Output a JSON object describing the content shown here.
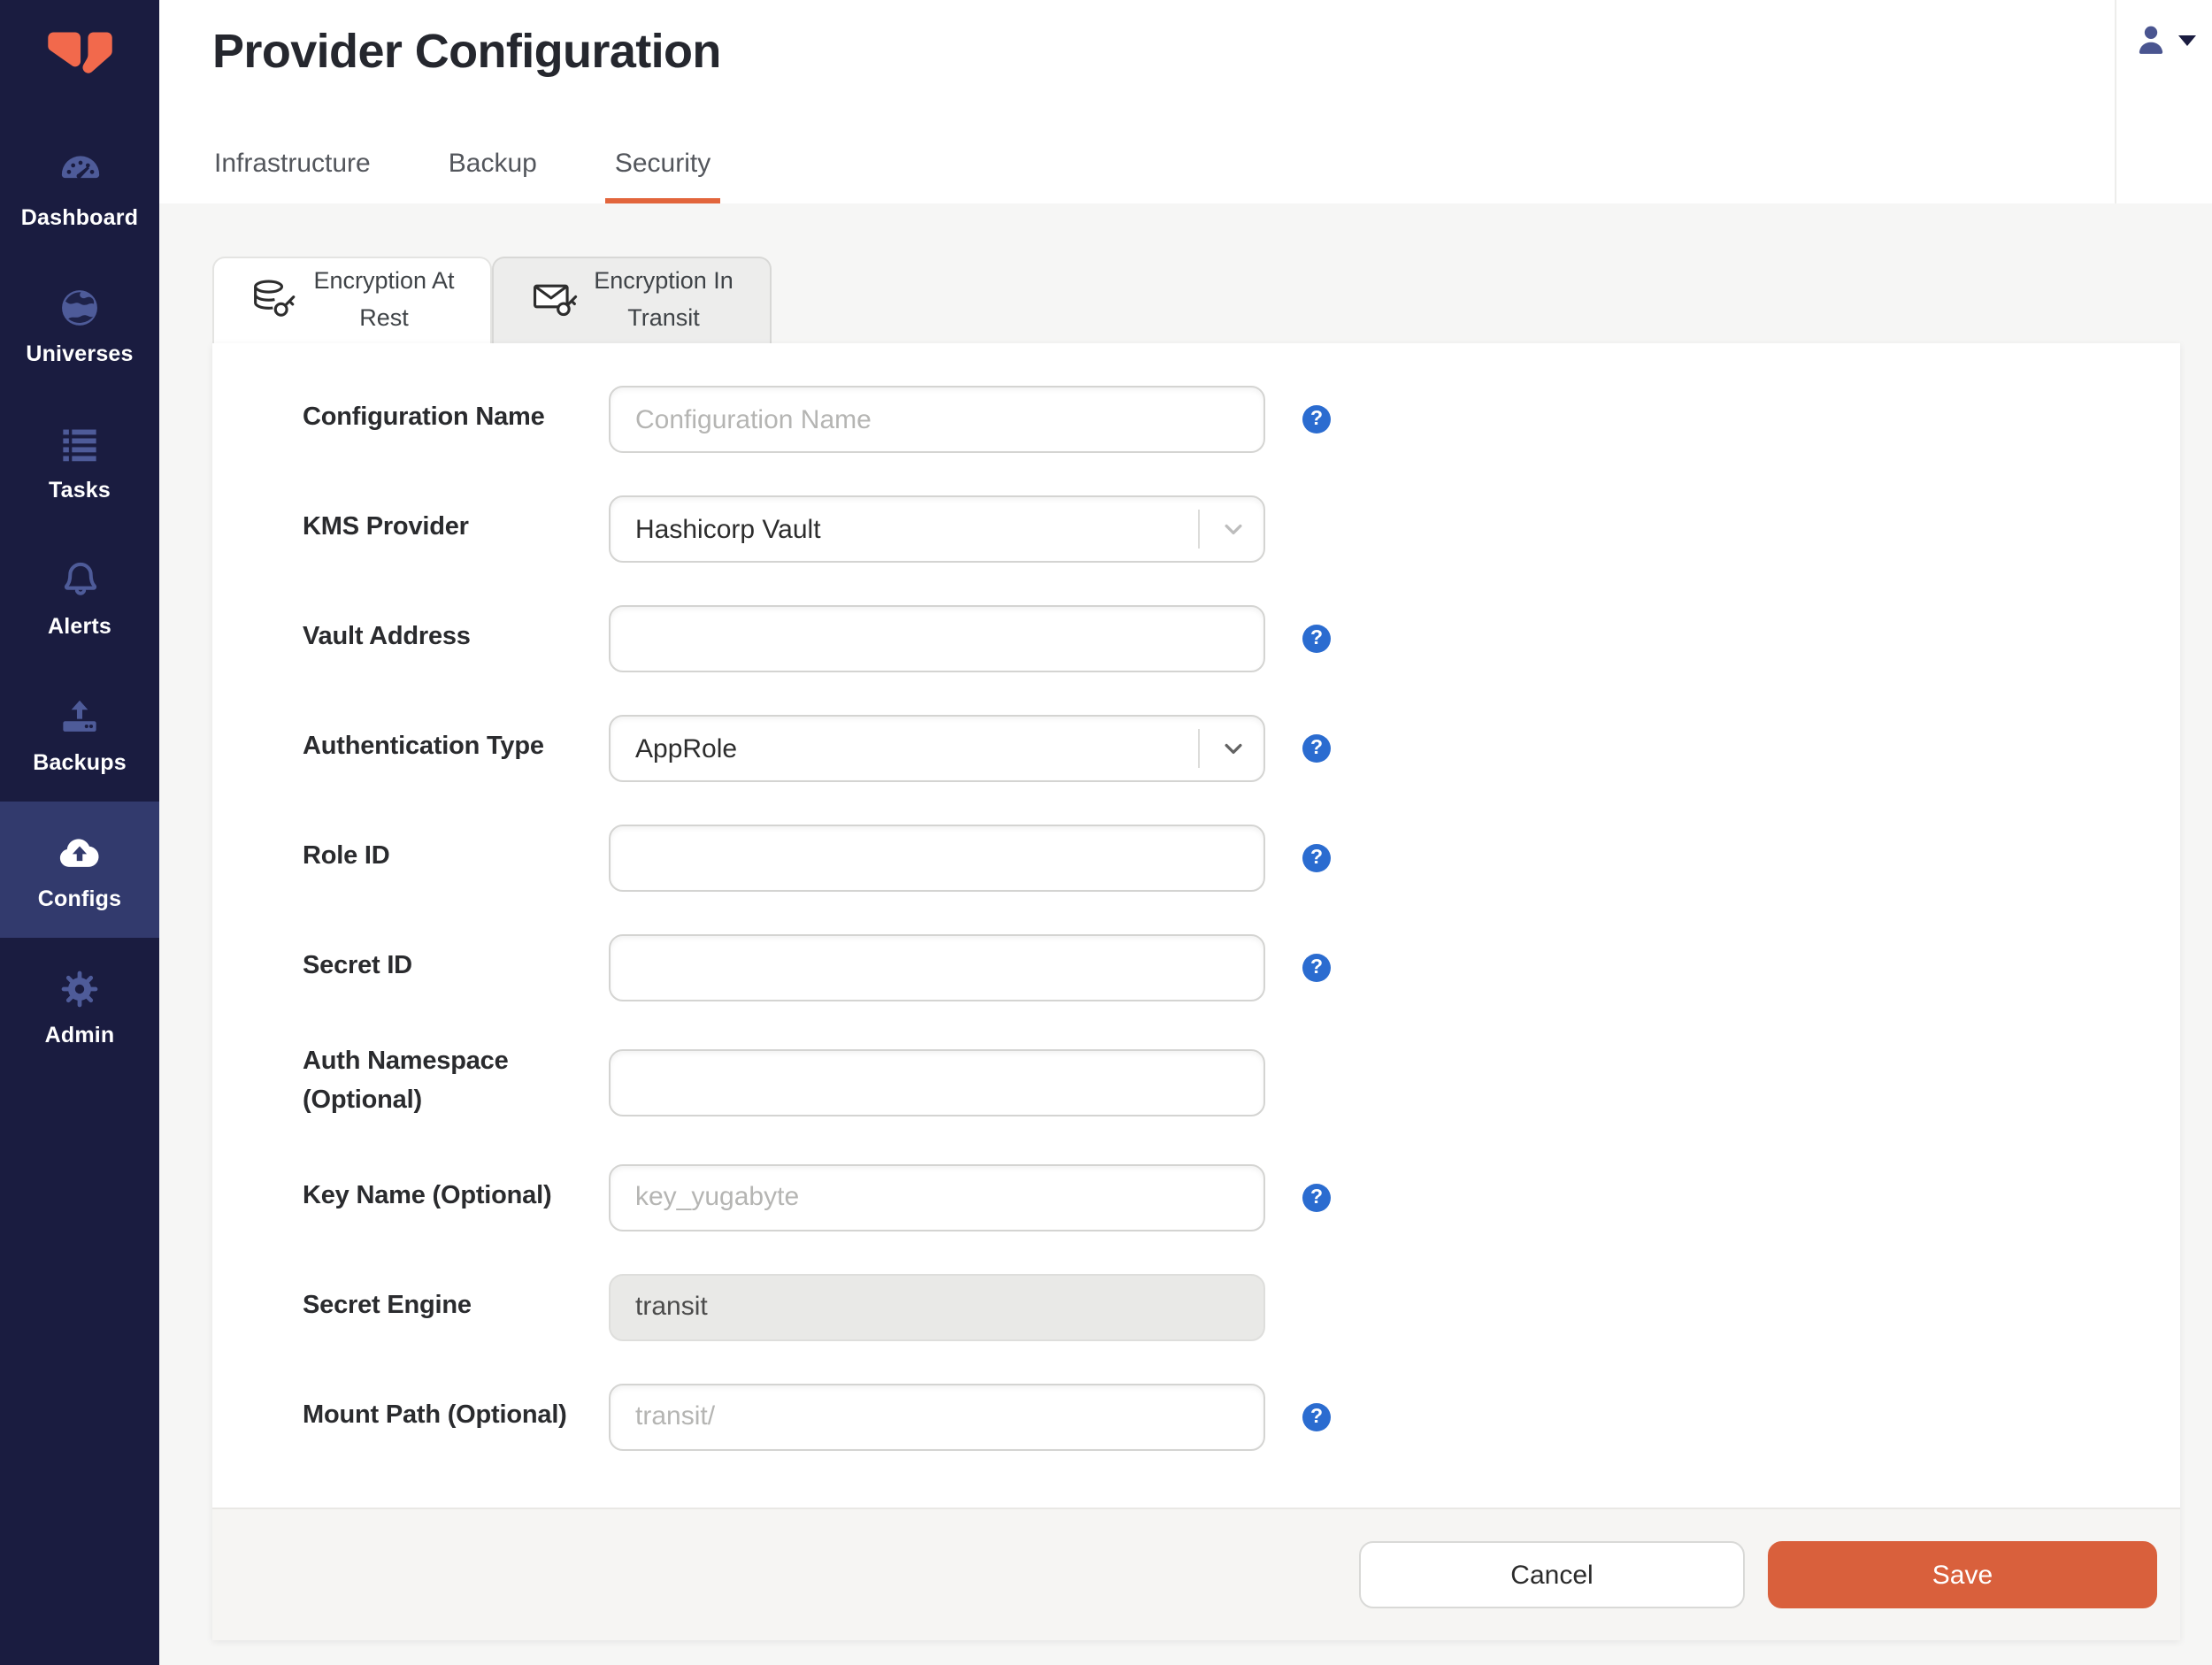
{
  "sidebar": {
    "items": [
      {
        "label": "Dashboard",
        "icon": "dashboard-gauge-icon",
        "active": false
      },
      {
        "label": "Universes",
        "icon": "globe-icon",
        "active": false
      },
      {
        "label": "Tasks",
        "icon": "task-list-icon",
        "active": false
      },
      {
        "label": "Alerts",
        "icon": "bell-icon",
        "active": false
      },
      {
        "label": "Backups",
        "icon": "upload-tray-icon",
        "active": false
      },
      {
        "label": "Configs",
        "icon": "cloud-upload-icon",
        "active": true
      },
      {
        "label": "Admin",
        "icon": "gear-icon",
        "active": false
      }
    ]
  },
  "header": {
    "title": "Provider Configuration",
    "tabs": [
      {
        "label": "Infrastructure",
        "active": false
      },
      {
        "label": "Backup",
        "active": false
      },
      {
        "label": "Security",
        "active": true
      }
    ],
    "user_menu": {
      "icon": "user-icon",
      "caret_icon": "chevron-down-icon"
    }
  },
  "content": {
    "tabs": [
      {
        "label_line1": "Encryption At",
        "label_line2": "Rest",
        "icon": "database-key-icon",
        "active": true
      },
      {
        "label_line1": "Encryption In",
        "label_line2": "Transit",
        "icon": "envelope-key-icon",
        "active": false
      }
    ],
    "form": {
      "fields": [
        {
          "label": "Configuration Name",
          "type": "text",
          "placeholder": "Configuration Name",
          "value": "",
          "disabled": false,
          "help": true
        },
        {
          "label": "KMS Provider",
          "type": "select",
          "value": "Hashicorp Vault",
          "help": false
        },
        {
          "label": "Vault Address",
          "type": "text",
          "placeholder": "",
          "value": "",
          "disabled": false,
          "help": true
        },
        {
          "label": "Authentication Type",
          "type": "select",
          "value": "AppRole",
          "help": true
        },
        {
          "label": "Role ID",
          "type": "text",
          "placeholder": "",
          "value": "",
          "disabled": false,
          "help": true
        },
        {
          "label": "Secret ID",
          "type": "text",
          "placeholder": "",
          "value": "",
          "disabled": false,
          "help": true
        },
        {
          "label": "Auth Namespace (Optional)",
          "type": "text",
          "placeholder": "",
          "value": "",
          "disabled": false,
          "help": false
        },
        {
          "label": "Key Name (Optional)",
          "type": "text",
          "placeholder": "key_yugabyte",
          "value": "",
          "disabled": false,
          "help": true
        },
        {
          "label": "Secret Engine",
          "type": "text",
          "placeholder": "",
          "value": "transit",
          "disabled": true,
          "help": false
        },
        {
          "label": "Mount Path (Optional)",
          "type": "text",
          "placeholder": "transit/",
          "value": "",
          "disabled": false,
          "help": true
        }
      ],
      "actions": {
        "cancel_label": "Cancel",
        "save_label": "Save"
      }
    }
  },
  "icons": {
    "help_glyph": "?"
  },
  "colors": {
    "accent_orange": "#D9603C",
    "tab_underline_orange": "#E2653C",
    "sidebar_bg": "#1A1C40",
    "sidebar_active_bg": "#323A6D",
    "sidebar_icon": "#4E5B99",
    "help_icon_blue": "#2B6CD0",
    "logo_orange": "#F2694C"
  }
}
